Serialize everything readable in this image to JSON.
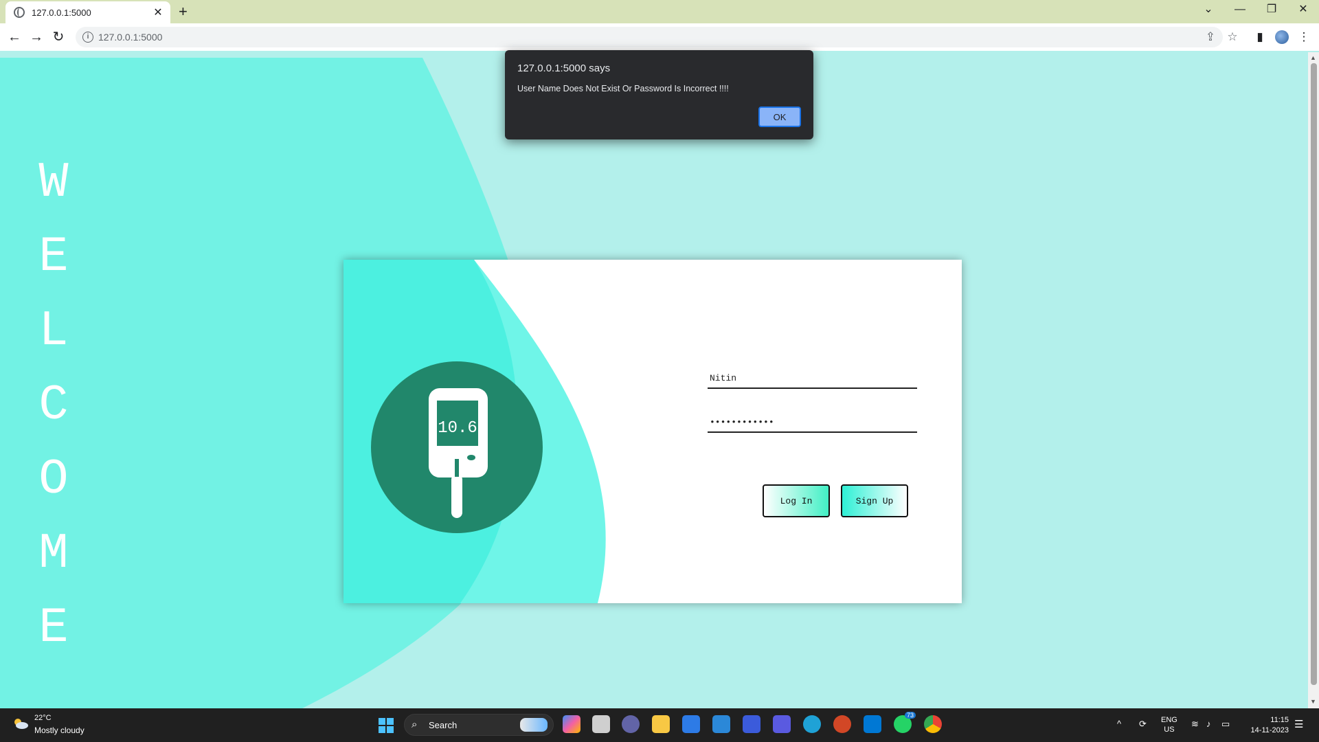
{
  "browser": {
    "tab_title": "127.0.0.1:5000",
    "tab_close": "✕",
    "new_tab": "+",
    "url": "127.0.0.1:5000",
    "window_controls": {
      "tab_search": "⌄",
      "minimize": "—",
      "restore": "❐",
      "close": "✕"
    },
    "nav": {
      "back": "←",
      "forward": "→",
      "reload": "↻"
    },
    "tools": {
      "share": "⇪",
      "bookmark": "☆",
      "side_panel": "▮",
      "menu": "⋮"
    }
  },
  "page": {
    "welcome_letters": [
      "W",
      "E",
      "L",
      "C",
      "O",
      "M",
      "E"
    ],
    "meter_reading": "10.6",
    "username_value": "Nitin",
    "password_value": "••••••••••••",
    "login_label": "Log In",
    "signup_label": "Sign Up"
  },
  "alert": {
    "title": "127.0.0.1:5000 says",
    "message": "User Name Does Not Exist Or Password Is Incorrect !!!!",
    "ok_label": "OK"
  },
  "taskbar": {
    "weather_temp": "22°C",
    "weather_desc": "Mostly cloudy",
    "search_label": "Search",
    "whatsapp_badge": "73",
    "lang_line1": "ENG",
    "lang_line2": "US",
    "time": "11:15",
    "date": "14-11-2023"
  },
  "colors": {
    "page_background": "#b3f0eb",
    "blob": "#72f2e4",
    "meter_circle": "#21876b",
    "alert_background": "#292a2d",
    "ok_button": "#8ab4f8"
  }
}
